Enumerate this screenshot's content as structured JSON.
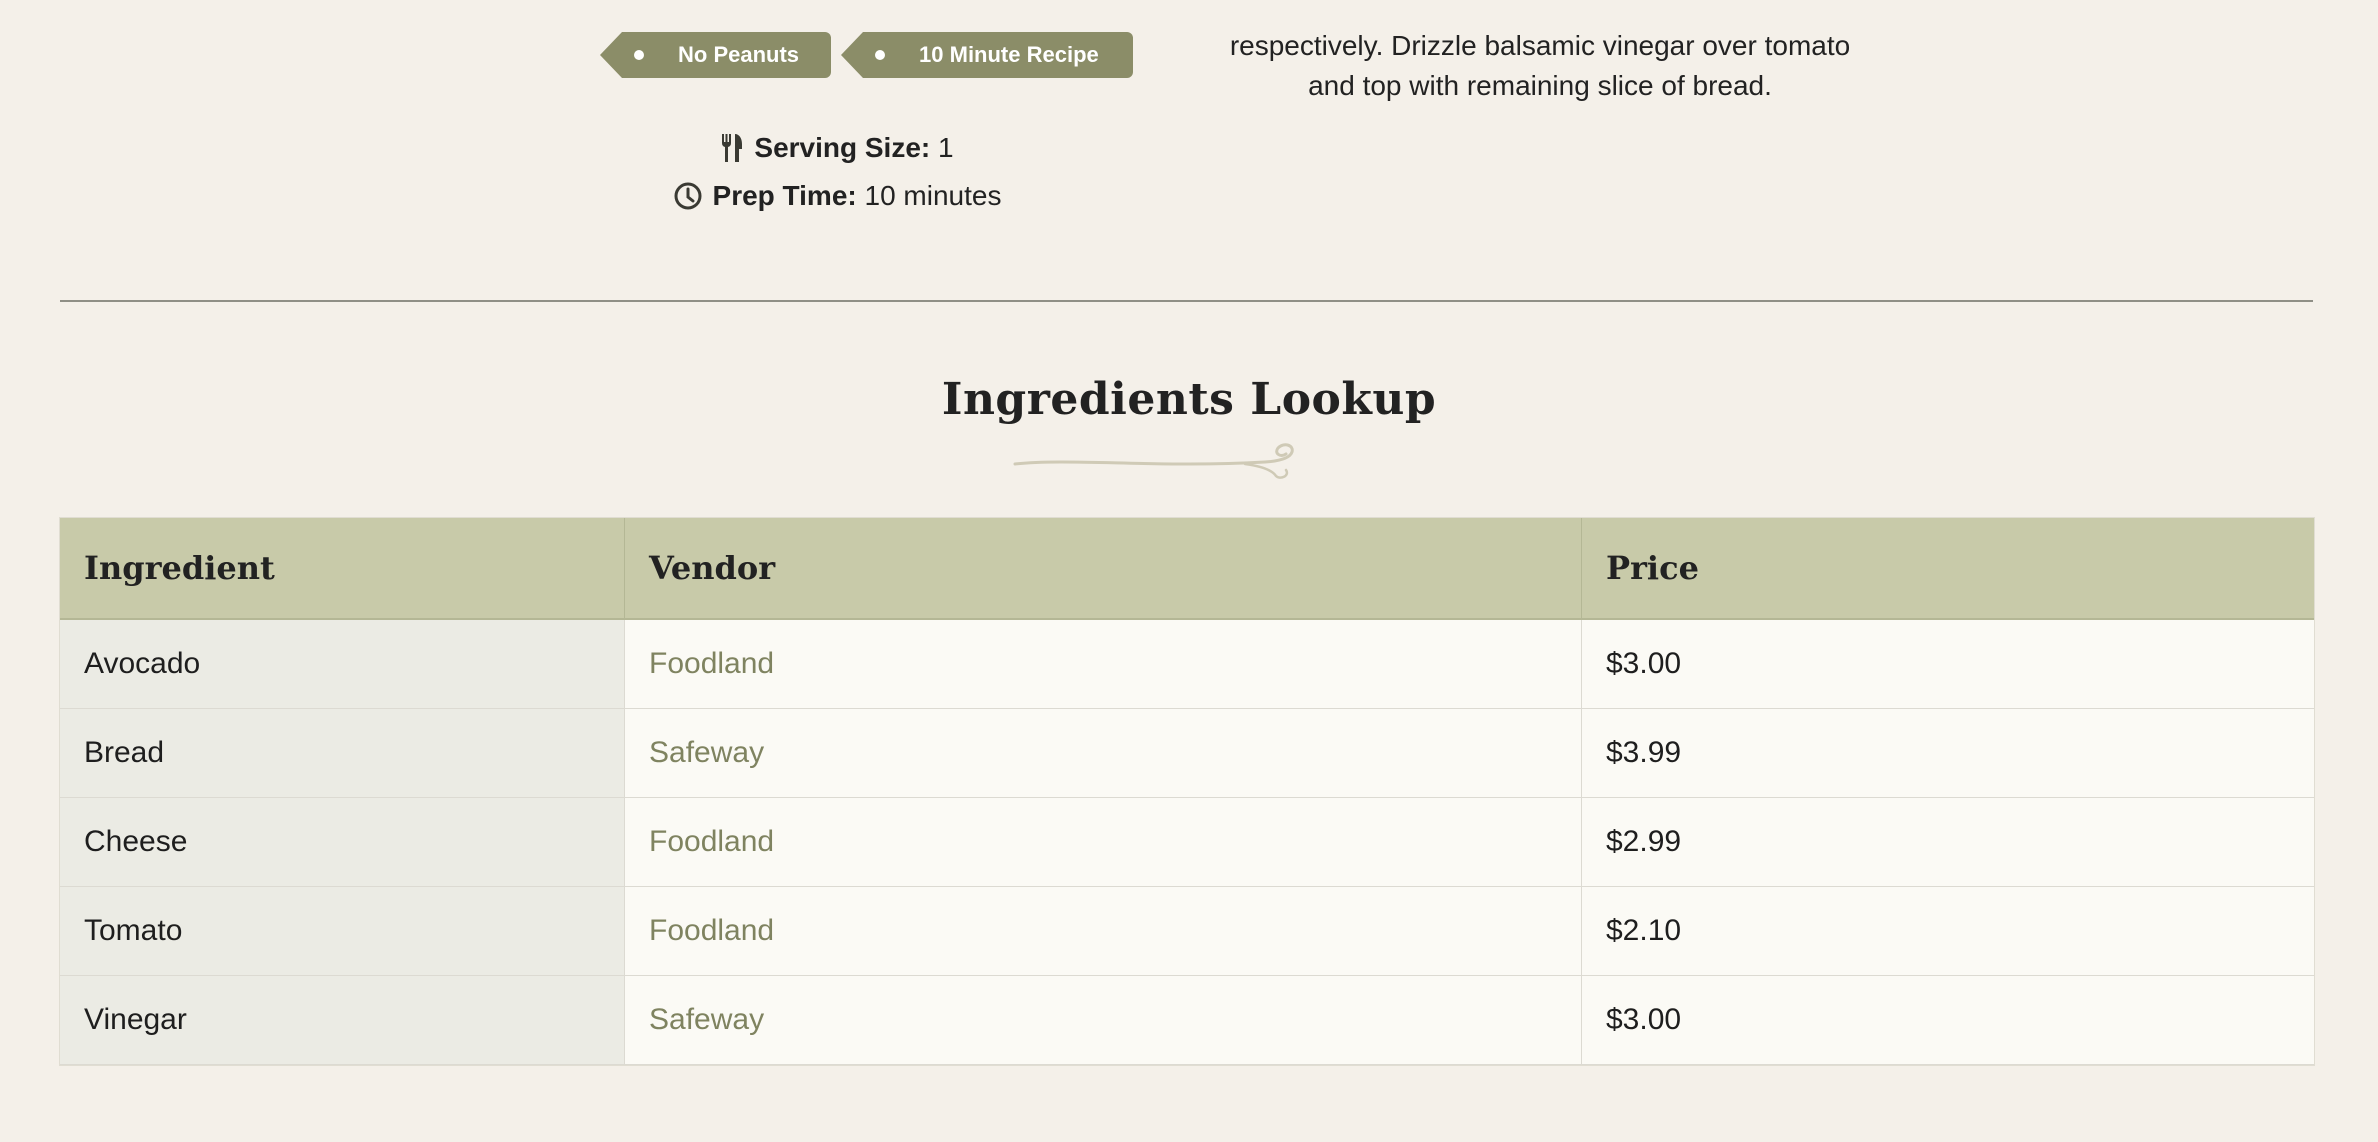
{
  "tags": [
    {
      "label": "No Peanuts"
    },
    {
      "label": "10 Minute Recipe"
    }
  ],
  "meta": {
    "serving_label": "Serving Size:",
    "serving_value": "1",
    "prep_label": "Prep Time:",
    "prep_value": "10 minutes"
  },
  "description": {
    "line1": "respectively. Drizzle balsamic vinegar over tomato",
    "line2": "and top with remaining slice of bread."
  },
  "section_title": "Ingredients Lookup",
  "table": {
    "headers": [
      "Ingredient",
      "Vendor",
      "Price"
    ],
    "rows": [
      {
        "ingredient": "Avocado",
        "vendor": "Foodland",
        "price": "$3.00"
      },
      {
        "ingredient": "Bread",
        "vendor": "Safeway",
        "price": "$3.99"
      },
      {
        "ingredient": "Cheese",
        "vendor": "Foodland",
        "price": "$2.99"
      },
      {
        "ingredient": "Tomato",
        "vendor": "Foodland",
        "price": "$2.10"
      },
      {
        "ingredient": "Vinegar",
        "vendor": "Safeway",
        "price": "$3.00"
      }
    ]
  },
  "colors": {
    "tag_bg": "#8b8d68",
    "header_bg": "#c8caa9",
    "vendor_link": "#7f8360",
    "page_bg": "#f4f0e9"
  },
  "icons": {
    "serving": "utensils-icon",
    "prep": "clock-icon",
    "divider_ornament": "flourish-ornament"
  }
}
